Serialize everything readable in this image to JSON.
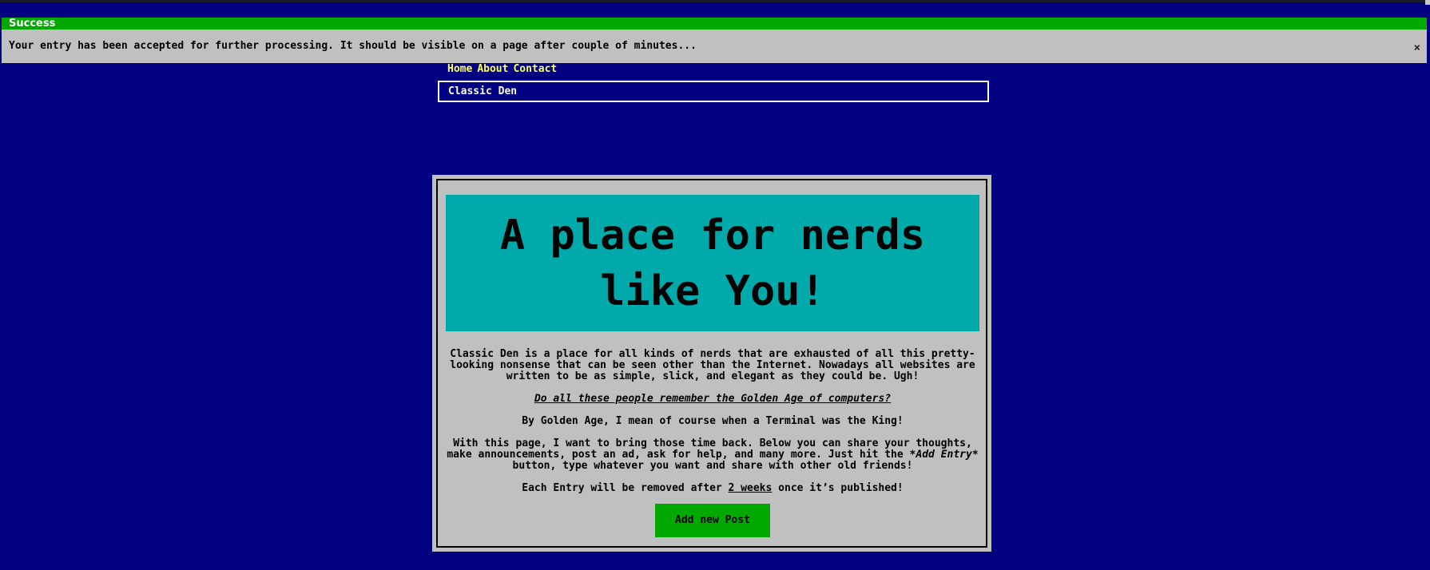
{
  "notification": {
    "title": "Success",
    "message": "Your entry has been accepted for further processing. It should be visible on a page after couple of minutes...",
    "close_icon": "×"
  },
  "nav": {
    "items": [
      "Home",
      "About",
      "Contact"
    ]
  },
  "site": {
    "title": "Classic Den"
  },
  "hero": {
    "line1": "A place for nerds",
    "line2": "like You!"
  },
  "intro": {
    "paragraph1": "Classic Den is a place for all kinds of nerds that are exhausted of all this pretty-looking nonsense that can be seen other than the Internet. Nowadays all websites are written to be as simple, slick, and elegant as they could be. Ugh!",
    "question": "Do all these people remember the Golden Age of computers?",
    "paragraph3": "By Golden Age, I mean of course when a Terminal was the King!",
    "paragraph4_part1": "With this page, I want to bring those time back. Below you can share your thoughts, make announcements, post an ad, ask for help, and many more. Just hit the ",
    "paragraph4_emph": "*Add Entry*",
    "paragraph4_part2": " button, type whatever you want and share with other old friends!",
    "paragraph5_part1": "Each Entry will be removed after ",
    "paragraph5_emph": "2 weeks",
    "paragraph5_part2": " once it’s published!"
  },
  "actions": {
    "add_post_label": "Add new Post"
  },
  "colors": {
    "background": "#000080",
    "success": "#00a800",
    "panel": "#c0c0c0",
    "hero": "#00aaaa",
    "nav_link": "#ffff55"
  }
}
